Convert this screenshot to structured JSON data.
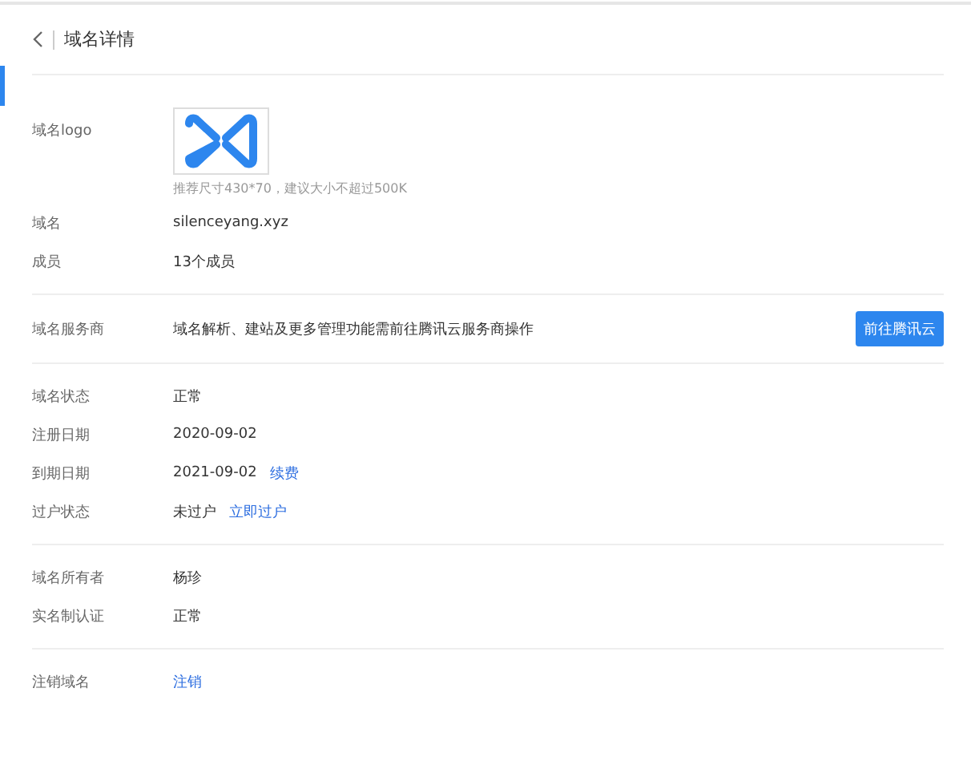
{
  "header": {
    "title": "域名详情"
  },
  "sections": [
    {
      "rows": [
        {
          "kind": "logo",
          "label": "域名logo",
          "hint": "推荐尺寸430*70，建议大小不超过500K"
        },
        {
          "kind": "text",
          "label": "域名",
          "value": "silenceyang.xyz"
        },
        {
          "kind": "text",
          "label": "成员",
          "value": "13个成员"
        }
      ]
    },
    {
      "rows": [
        {
          "kind": "action",
          "label": "域名服务商",
          "value": "域名解析、建站及更多管理功能需前往腾讯云服务商操作",
          "button": "前往腾讯云"
        }
      ]
    },
    {
      "rows": [
        {
          "kind": "text",
          "label": "域名状态",
          "value": "正常"
        },
        {
          "kind": "text",
          "label": "注册日期",
          "value": "2020-09-02"
        },
        {
          "kind": "text",
          "label": "到期日期",
          "value": "2021-09-02",
          "link": "续费"
        },
        {
          "kind": "text",
          "label": "过户状态",
          "value": "未过户",
          "link": "立即过户"
        }
      ]
    },
    {
      "rows": [
        {
          "kind": "text",
          "label": "域名所有者",
          "value": "杨珍"
        },
        {
          "kind": "text",
          "label": "实名制认证",
          "value": "正常"
        }
      ]
    },
    {
      "rows": [
        {
          "kind": "text",
          "label": "注销域名",
          "link": "注销"
        }
      ]
    }
  ]
}
